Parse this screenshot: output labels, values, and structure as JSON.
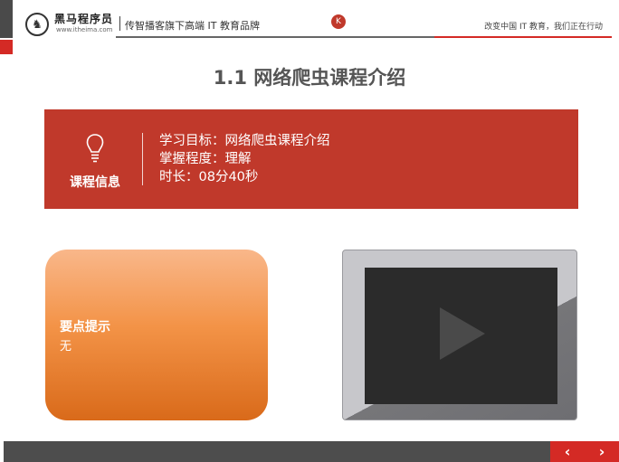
{
  "header": {
    "brand_name": "黑马程序员",
    "brand_url": "www.itheima.com",
    "tagline": "传智播客旗下高端 IT 教育品牌",
    "badge": "K",
    "slogan": "改变中国 IT 教育，我们正在行动"
  },
  "slide": {
    "title": "1.1 网络爬虫课程介绍"
  },
  "course_info": {
    "label": "课程信息",
    "lines": [
      "学习目标：网络爬虫课程介绍",
      "掌握程度：理解",
      "时长：08分40秒"
    ]
  },
  "tips": {
    "title": "要点提示",
    "body": "无"
  },
  "nav": {
    "prev": "‹",
    "next": "›"
  },
  "colors": {
    "accent": "#c0392b",
    "brand_red": "#d42a25",
    "footer": "#4d4d4d",
    "tips_orange": "#f39347"
  },
  "icons": {
    "logo": "horse-logo-icon",
    "bulb": "lightbulb-icon",
    "play": "play-icon"
  }
}
